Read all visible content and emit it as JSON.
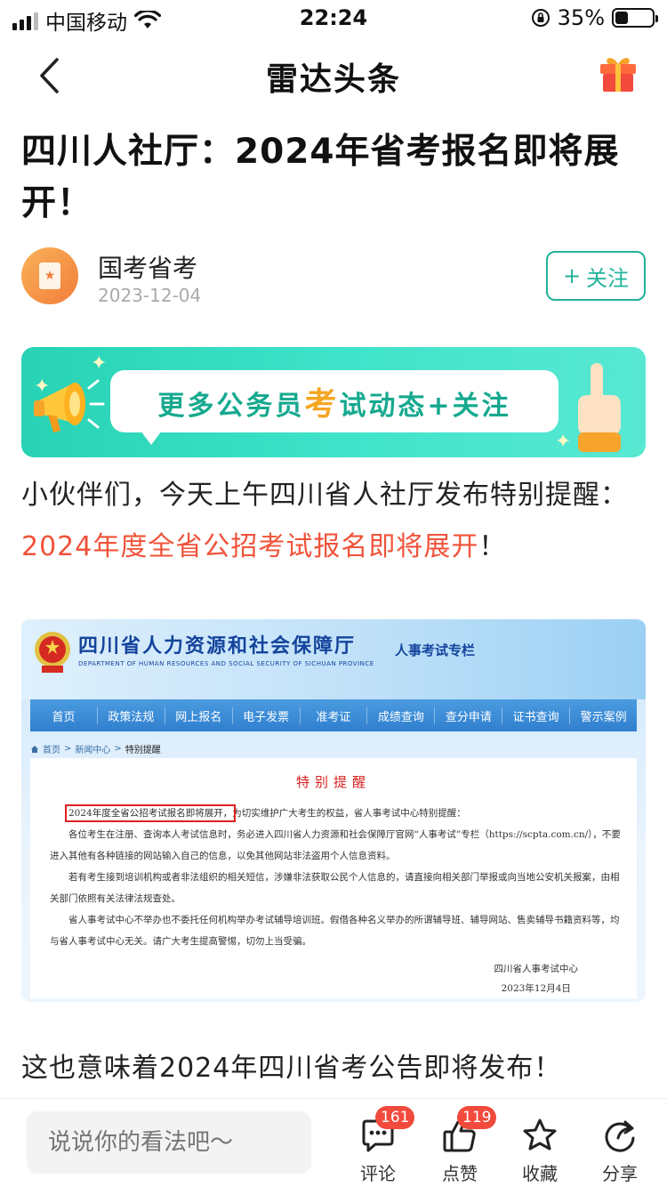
{
  "status_bar": {
    "carrier": "中国移动",
    "time": "22:24",
    "battery": "35%",
    "battery_level": 0.35
  },
  "nav": {
    "title": "雷达头条"
  },
  "article": {
    "title": "四川人社厅：2024年省考报名即将展开！",
    "author": "国考省考",
    "date": "2023-12-04",
    "follow_label": "关注",
    "follow_icon": "+"
  },
  "banner": {
    "text_before": "更多公务员",
    "text_highlight": "考",
    "text_after": "试动态+关注"
  },
  "paragraph1": {
    "text": "小伙伴们，今天上午四川省人社厅发布特别提醒：",
    "highlight": "2024年度全省公招考试报名即将展开",
    "end": "！"
  },
  "screenshot": {
    "org_name": "四川省人力资源和社会保障厅",
    "org_name_en": "DEPARTMENT OF HUMAN RESOURCES AND SOCIAL SECURITY OF SICHUAN PROVINCE",
    "column_title": "人事考试专栏",
    "nav_items": [
      "首页",
      "政策法规",
      "网上报名",
      "电子发票",
      "准考证",
      "成绩查询",
      "查分申请",
      "证书查询",
      "警示案例"
    ],
    "breadcrumb": [
      "首页",
      "新闻中心",
      "特别提醒"
    ],
    "notice_title": "特别提醒",
    "notice_p1_boxed": "2024年度全省公招考试报名即将展开，",
    "notice_p1_rest": "为切实维护广大考生的权益，省人事考试中心特别提醒：",
    "notice_p2": "各位考生在注册、查询本人考试信息时，务必进入四川省人力资源和社会保障厅官网“人事考试”专栏（https://scpta.com.cn/），不要进入其他有各种链接的网站输入自己的信息，以免其他网站非法盗用个人信息资料。",
    "notice_p3": "若有考生接到培训机构或者非法组织的相关短信，涉嫌非法获取公民个人信息的，请直接向相关部门举报或向当地公安机关报案，由相关部门依照有关法律法规查处。",
    "notice_p4": "省人事考试中心不举办也不委托任何机构举办考试辅导培训班。假借各种名义举办的所谓辅导班、辅导网站、售卖辅导书籍资料等，均与省人事考试中心无关。请广大考生提高警惕，切勿上当受骗。",
    "notice_sign_org": "四川省人事考试中心",
    "notice_sign_date": "2023年12月4日"
  },
  "paragraph2": {
    "text": "这也意味着2024年四川省考公告即将发布！"
  },
  "bottom_bar": {
    "comment_placeholder": "说说你的看法吧～",
    "actions": [
      {
        "label": "评论",
        "badge": "161",
        "icon": "comment-icon"
      },
      {
        "label": "点赞",
        "badge": "119",
        "icon": "thumbs-up-icon"
      },
      {
        "label": "收藏",
        "icon": "star-icon"
      },
      {
        "label": "分享",
        "icon": "share-icon"
      }
    ]
  },
  "colors": {
    "accent": "#1fb39a",
    "highlight_red": "#f0533a",
    "badge_red": "#f24a3c",
    "banner_green": "#3ee3c9"
  }
}
